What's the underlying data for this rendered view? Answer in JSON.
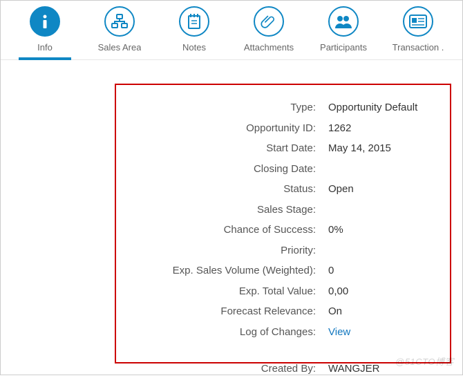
{
  "tabs": [
    {
      "id": "info",
      "label": "Info",
      "icon": "info-icon"
    },
    {
      "id": "sales-area",
      "label": "Sales Area",
      "icon": "org-icon"
    },
    {
      "id": "notes",
      "label": "Notes",
      "icon": "notepad-icon"
    },
    {
      "id": "attachments",
      "label": "Attachments",
      "icon": "paperclip-icon"
    },
    {
      "id": "participants",
      "label": "Participants",
      "icon": "people-icon"
    },
    {
      "id": "transaction",
      "label": "Transaction .",
      "icon": "card-icon"
    }
  ],
  "active_tab": "info",
  "details": {
    "type": {
      "label": "Type:",
      "value": "Opportunity Default"
    },
    "opportunity_id": {
      "label": "Opportunity ID:",
      "value": "1262"
    },
    "start_date": {
      "label": "Start Date:",
      "value": "May 14, 2015"
    },
    "closing_date": {
      "label": "Closing Date:",
      "value": ""
    },
    "status": {
      "label": "Status:",
      "value": "Open"
    },
    "sales_stage": {
      "label": "Sales Stage:",
      "value": ""
    },
    "chance": {
      "label": "Chance of Success:",
      "value": "0%"
    },
    "priority": {
      "label": "Priority:",
      "value": ""
    },
    "exp_sales_weighted": {
      "label": "Exp. Sales Volume (Weighted):",
      "value": "0"
    },
    "exp_total_value": {
      "label": "Exp. Total Value:",
      "value": "0,00"
    },
    "forecast_relevance": {
      "label": "Forecast Relevance:",
      "value": "On"
    },
    "log_of_changes": {
      "label": "Log of Changes:",
      "value": "View"
    },
    "created_by": {
      "label": "Created By:",
      "value": "WANGJER"
    }
  },
  "watermark": "@51CTO博客",
  "colors": {
    "accent": "#0f87c4"
  }
}
